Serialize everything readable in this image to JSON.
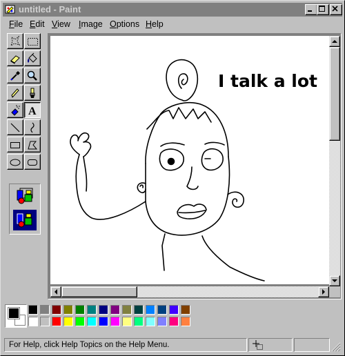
{
  "window": {
    "title": "untitled - Paint"
  },
  "menubar": {
    "items": [
      "File",
      "Edit",
      "View",
      "Image",
      "Options",
      "Help"
    ]
  },
  "toolbox": {
    "tools": [
      {
        "name": "free-form-select",
        "icon": "free-form-select-icon"
      },
      {
        "name": "select",
        "icon": "rectangle-select-icon"
      },
      {
        "name": "eraser",
        "icon": "eraser-icon"
      },
      {
        "name": "fill-with-color",
        "icon": "paint-bucket-icon"
      },
      {
        "name": "pick-color",
        "icon": "eyedropper-icon"
      },
      {
        "name": "magnifier",
        "icon": "magnifier-icon"
      },
      {
        "name": "pencil",
        "icon": "pencil-icon"
      },
      {
        "name": "brush",
        "icon": "brush-icon"
      },
      {
        "name": "airbrush",
        "icon": "airbrush-icon"
      },
      {
        "name": "text",
        "icon": "text-icon",
        "label": "A"
      },
      {
        "name": "line",
        "icon": "line-icon"
      },
      {
        "name": "curve",
        "icon": "curve-icon"
      },
      {
        "name": "rectangle",
        "icon": "rectangle-icon"
      },
      {
        "name": "polygon",
        "icon": "polygon-icon"
      },
      {
        "name": "ellipse",
        "icon": "ellipse-icon"
      },
      {
        "name": "rounded-rectangle",
        "icon": "rounded-rectangle-icon"
      }
    ],
    "selected_tool": "text",
    "options": [
      "opaque-background-icon",
      "transparent-background-icon"
    ],
    "selected_option": "transparent-background-icon"
  },
  "canvas": {
    "text": "I talk a lot",
    "drawing": "hand-drawn-figure"
  },
  "palette": {
    "foreground": "#000000",
    "background": "#ffffff",
    "colors_top": [
      "#000000",
      "#808080",
      "#800000",
      "#808000",
      "#008000",
      "#008080",
      "#000080",
      "#800080",
      "#808040",
      "#004040",
      "#0080ff",
      "#004080",
      "#4000ff",
      "#804000"
    ],
    "colors_bottom": [
      "#ffffff",
      "#c0c0c0",
      "#ff0000",
      "#ffff00",
      "#00ff00",
      "#00ffff",
      "#0000ff",
      "#ff00ff",
      "#ffff80",
      "#00ff80",
      "#80ffff",
      "#8080ff",
      "#ff0080",
      "#ff8040"
    ]
  },
  "statusbar": {
    "help_text": "For Help, click Help Topics on the Help Menu."
  }
}
